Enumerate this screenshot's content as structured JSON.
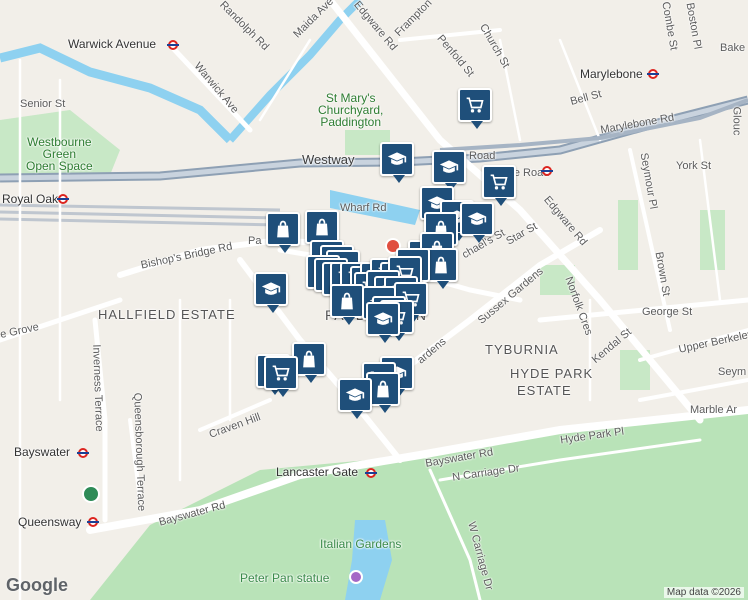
{
  "map": {
    "attribution": "Map data ©2026",
    "logo": "Google",
    "colors": {
      "land": "#f2efe9",
      "water": "#8ed1f0",
      "park": "#b9e3b8",
      "road": "#ffffff",
      "major_road": "#a6b4c4",
      "highway": "#8ea0b4",
      "marker": "#1f4f7a",
      "station": "#dc241f"
    },
    "areas": [
      {
        "id": "hallfield",
        "text": "HALLFIELD ESTATE"
      },
      {
        "id": "tyburnia",
        "text": "TYBURNIA"
      },
      {
        "id": "hydepark1",
        "text": "HYDE PARK"
      },
      {
        "id": "hydepark2",
        "text": "ESTATE"
      },
      {
        "id": "paddington",
        "text": "PADDINGTON"
      }
    ],
    "streets": [
      {
        "id": "randolph",
        "text": "Randolph Rd"
      },
      {
        "id": "maida",
        "text": "Maida Ave"
      },
      {
        "id": "edgware_top",
        "text": "Edgware Rd"
      },
      {
        "id": "frampton",
        "text": "Frampton"
      },
      {
        "id": "penfold",
        "text": "Penfold St"
      },
      {
        "id": "church",
        "text": "Church St"
      },
      {
        "id": "warwick",
        "text": "Warwick Ave"
      },
      {
        "id": "senior",
        "text": "Senior St"
      },
      {
        "id": "westway",
        "text": "Westway"
      },
      {
        "id": "wharf",
        "text": "Wharf Rd"
      },
      {
        "id": "bishops",
        "text": "Bishop's Bridge Rd"
      },
      {
        "id": "praed",
        "text": "Pa"
      },
      {
        "id": "grove",
        "text": "e Grove"
      },
      {
        "id": "inverness",
        "text": "Inverness Terrace"
      },
      {
        "id": "queensbo",
        "text": "Queensborough Terrace"
      },
      {
        "id": "craven",
        "text": "Craven Hill"
      },
      {
        "id": "bayswater_rd1",
        "text": "Bayswater Rd"
      },
      {
        "id": "bayswater_rd2",
        "text": "Bayswater Rd"
      },
      {
        "id": "hydeparkpl",
        "text": "Hyde Park Pl"
      },
      {
        "id": "ncarriage",
        "text": "N Carriage Dr"
      },
      {
        "id": "wcarriage",
        "text": "W Carriage Dr"
      },
      {
        "id": "sussex",
        "text": "Sussex Gardens"
      },
      {
        "id": "gardens",
        "text": "ardens"
      },
      {
        "id": "norfolk",
        "text": "Norfolk Cres"
      },
      {
        "id": "kendal",
        "text": "Kendal St"
      },
      {
        "id": "george",
        "text": "George St"
      },
      {
        "id": "upperberk",
        "text": "Upper Berkeley"
      },
      {
        "id": "seym",
        "text": "Seym"
      },
      {
        "id": "marblear",
        "text": "Marble Ar"
      },
      {
        "id": "brown",
        "text": "Brown St"
      },
      {
        "id": "seymourpl",
        "text": "Seymour Pl"
      },
      {
        "id": "yorkst",
        "text": "York St"
      },
      {
        "id": "marylebonerd",
        "text": "Marylebone Rd"
      },
      {
        "id": "edgware_mid",
        "text": "Edgware Rd"
      },
      {
        "id": "star",
        "text": "Star St"
      },
      {
        "id": "michaels",
        "text": "chael's St"
      },
      {
        "id": "bellst",
        "text": "Bell St"
      },
      {
        "id": "boston",
        "text": "Boston Pl"
      },
      {
        "id": "combe",
        "text": "Combe St"
      },
      {
        "id": "glouc",
        "text": "Glouc"
      },
      {
        "id": "bake",
        "text": "Bake"
      },
      {
        "id": "edgwarerd_station",
        "text": "gware Road"
      },
      {
        "id": "edgwarerd_station2",
        "text": "gware Road"
      }
    ],
    "places": [
      {
        "id": "stmarys",
        "lines": [
          "St Mary's",
          "Churchyard,",
          "Paddington"
        ]
      },
      {
        "id": "westbourne",
        "lines": [
          "Westbourne",
          "Green",
          "Open Space"
        ]
      },
      {
        "id": "italian",
        "lines": [
          "Italian Gardens"
        ]
      },
      {
        "id": "peterpan",
        "lines": [
          "Peter Pan statue"
        ]
      }
    ],
    "stations": [
      {
        "id": "warwickave",
        "text": "Warwick Avenue"
      },
      {
        "id": "royaloak",
        "text": "Royal Oak"
      },
      {
        "id": "marylebone",
        "text": "Marylebone"
      },
      {
        "id": "lancastergate",
        "text": "Lancaster Gate"
      },
      {
        "id": "bayswater",
        "text": "Bayswater"
      },
      {
        "id": "queensway",
        "text": "Queensway"
      }
    ],
    "marker_icons": [
      "graduation-cap-icon",
      "shopping-bag-icon",
      "shopping-cart-icon"
    ]
  }
}
